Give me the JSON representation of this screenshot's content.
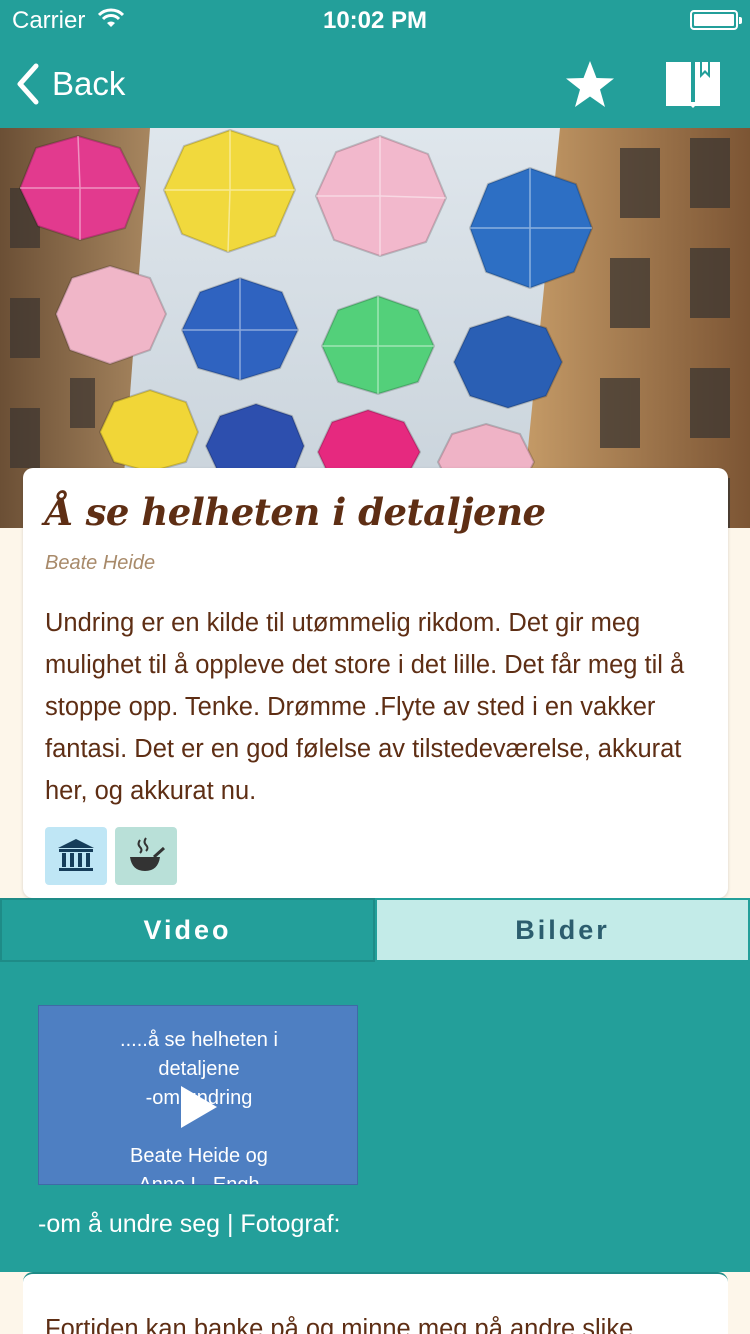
{
  "status_bar": {
    "carrier": "Carrier",
    "time": "10:02 PM"
  },
  "nav": {
    "back_label": "Back",
    "icons": [
      "chevron-left-icon",
      "star-icon",
      "book-bookmark-icon"
    ]
  },
  "article": {
    "title": "Å se helheten i detaljene",
    "author": "Beate Heide",
    "body": "Undring er en kilde til utømmelig rikdom. Det gir meg mulighet til å oppleve det store i det lille. Det får meg til å stoppe opp. Tenke. Drømme .Flyte av sted i en vakker fantasi. Det er en god følelse av tilstedeværelse, akkurat her, og akkurat nu.",
    "tags": [
      "museum-icon",
      "cooking-pot-icon"
    ]
  },
  "tabs": {
    "video_label": "Video",
    "bilder_label": "Bilder",
    "selected": "Video"
  },
  "video": {
    "thumb_line1": ".....å se helheten i",
    "thumb_line2": "detaljene",
    "thumb_line3": "-om undring",
    "thumb_line4": "Beate Heide og",
    "thumb_line5": "Anne L. Engh",
    "caption": "-om å undre seg | Fotograf:"
  },
  "second_card": {
    "body": "Fortiden kan banke på og minne meg på andre slike"
  },
  "colors": {
    "teal": "#239f9a",
    "brown": "#5e2e14",
    "cream": "#fdf6ea"
  }
}
